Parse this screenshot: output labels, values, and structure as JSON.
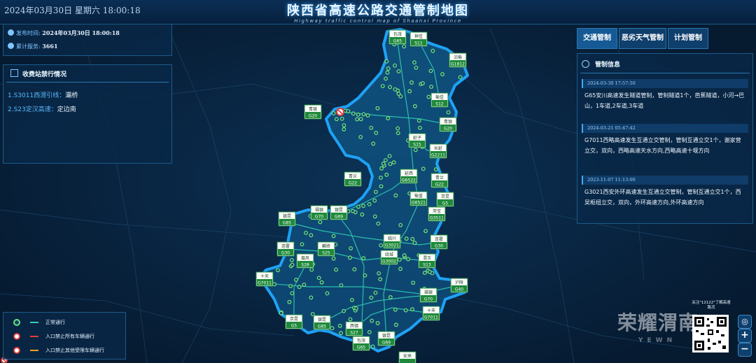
{
  "header": {
    "datetime": "2024年03月30日 星期六  18:00:18",
    "title": "陕西省高速公路交通管制地图",
    "subtitle": "Highway traffic control map of Shaanxi Province"
  },
  "info": {
    "publish_label": "发布时间:",
    "publish_value": "2024年03月30日  18:00:18",
    "service_label": "累计服务:",
    "service_value": "3661"
  },
  "toll_panel": {
    "title": "收费站禁行情况",
    "items": [
      {
        "road": "1.S3011西渭引线：",
        "place": "灞桥"
      },
      {
        "road": "2.S23定汉高速：",
        "place": "定边南"
      }
    ]
  },
  "tabs": [
    {
      "label": "交通管制"
    },
    {
      "label": "恶劣天气管制"
    },
    {
      "label": "计划管制"
    }
  ],
  "control": {
    "title": "管制信息",
    "records": [
      {
        "time": "2024-03-30 17:57:50",
        "text": "G65安川高速发生隧道管制，管制隧道1个，芭蕉隧道，小河→巴山，1车道,2车道,3车道"
      },
      {
        "time": "2024-03-21 05:47:42",
        "text": "G7011西略高速发生互通立交管制，管制互通立交1个，谢家营立交，双向，西略高速天水方向,西略高速十堰方向"
      },
      {
        "time": "2023-11-07 11:13:00",
        "text": "G3021西安外环高速发生互通立交管制，管制互通立交1个，西吴枢纽立交，双向，外环高速方向,外环高速方向"
      }
    ]
  },
  "legend": {
    "items": [
      {
        "label": "正常通行",
        "dot": "#6fe07a",
        "line": "#2fd3b6"
      },
      {
        "label": "入口禁止所有车辆通行",
        "dot": "#e23b3b",
        "line": "#e23b3b"
      },
      {
        "label": "入口禁止其他受限车辆通行",
        "dot": "#e23b3b",
        "line": "#f0a020"
      }
    ]
  },
  "qr": {
    "caption": "关注\"12122\"了解高速路况"
  },
  "watermark": {
    "text": "荣耀渭南",
    "sub": "YEWN"
  },
  "colors": {
    "normal": "#6fe07a",
    "route_line": "#2fd3b6",
    "restrict": "#e23b3b",
    "partial": "#f0a020",
    "province_border": "#1ea2f5",
    "shield_green": "#1f8a3a"
  },
  "chart_data": {
    "type": "map",
    "region": "陕西省",
    "markers": [
      {
        "name": "包茂",
        "code": "G65"
      },
      {
        "name": "神佳",
        "code": "S11"
      },
      {
        "name": "沿榆",
        "code": "G1812"
      },
      {
        "name": "榆佳",
        "code": "S12"
      },
      {
        "name": "青银",
        "code": "G20"
      },
      {
        "name": "青银",
        "code": "G20"
      },
      {
        "name": "延子",
        "code": "S15"
      },
      {
        "name": "长延",
        "code": "G2211"
      },
      {
        "name": "延西",
        "code": "G6522"
      },
      {
        "name": "青兰",
        "code": "G22"
      },
      {
        "name": "青兰",
        "code": "G22"
      },
      {
        "name": "榆蓝",
        "code": "G6521"
      },
      {
        "name": "京昆",
        "code": "G5"
      },
      {
        "name": "福银",
        "code": "G70"
      },
      {
        "name": "银昆",
        "code": "G69"
      },
      {
        "name": "银昆",
        "code": "G85"
      },
      {
        "name": "菏宝",
        "code": "G3511"
      },
      {
        "name": "临兴",
        "code": "G3021"
      },
      {
        "name": "连霍",
        "code": "G30"
      },
      {
        "name": "连霍",
        "code": "G30"
      },
      {
        "name": "麟绛",
        "code": "S25"
      },
      {
        "name": "绕城",
        "code": "G3002"
      },
      {
        "name": "眉凤",
        "code": "S28"
      },
      {
        "name": "渭玉",
        "code": "S13"
      },
      {
        "name": "十天",
        "code": "G7011"
      },
      {
        "name": "沪陕",
        "code": "G40"
      },
      {
        "name": "福银",
        "code": "G70"
      },
      {
        "name": "十天",
        "code": "G7011"
      },
      {
        "name": "京昆",
        "code": "G5"
      },
      {
        "name": "银昆",
        "code": "G85"
      },
      {
        "name": "西镇",
        "code": "S27"
      },
      {
        "name": "包茂",
        "code": "G65"
      },
      {
        "name": "银昆",
        "code": "G69"
      },
      {
        "name": "安来",
        "code": ""
      }
    ],
    "restricted_stations": [
      "灞桥",
      "定边南"
    ]
  }
}
